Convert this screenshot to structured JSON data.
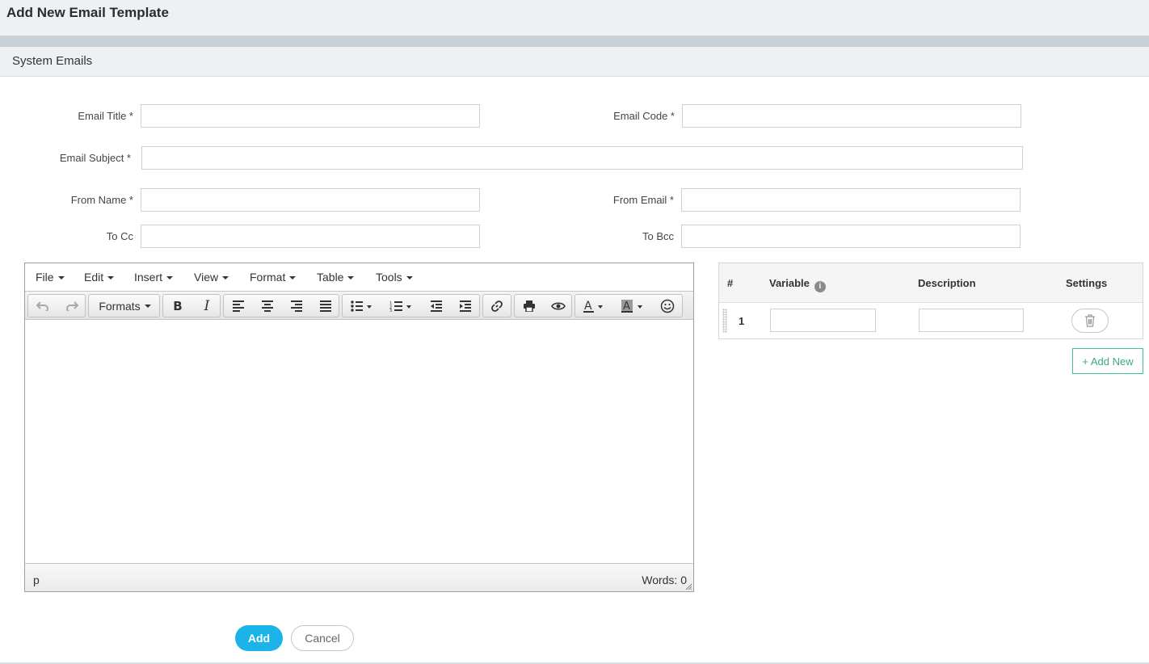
{
  "header": {
    "title": "Add New Email Template"
  },
  "section": {
    "title": "System Emails"
  },
  "form": {
    "email_title_label": "Email Title *",
    "email_code_label": "Email Code *",
    "email_subject_label": "Email Subject *",
    "from_name_label": "From Name *",
    "from_email_label": "From Email *",
    "to_cc_label": "To Cc",
    "to_bcc_label": "To Bcc",
    "email_title_value": "",
    "email_code_value": "",
    "email_subject_value": "",
    "from_name_value": "",
    "from_email_value": "",
    "to_cc_value": "",
    "to_bcc_value": ""
  },
  "editor": {
    "menus": [
      "File",
      "Edit",
      "Insert",
      "View",
      "Format",
      "Table",
      "Tools"
    ],
    "formats_label": "Formats",
    "status_path": "p",
    "word_count": "Words: 0"
  },
  "variables": {
    "headers": {
      "num": "#",
      "variable": "Variable",
      "description": "Description",
      "settings": "Settings"
    },
    "rows": [
      {
        "num": "1",
        "variable": "",
        "description": ""
      }
    ],
    "add_new_label": "+ Add New"
  },
  "actions": {
    "add_label": "Add",
    "cancel_label": "Cancel"
  },
  "colors": {
    "primary": "#1cb4e8",
    "success": "#3fbf94",
    "header_bg": "#eef1f3"
  }
}
